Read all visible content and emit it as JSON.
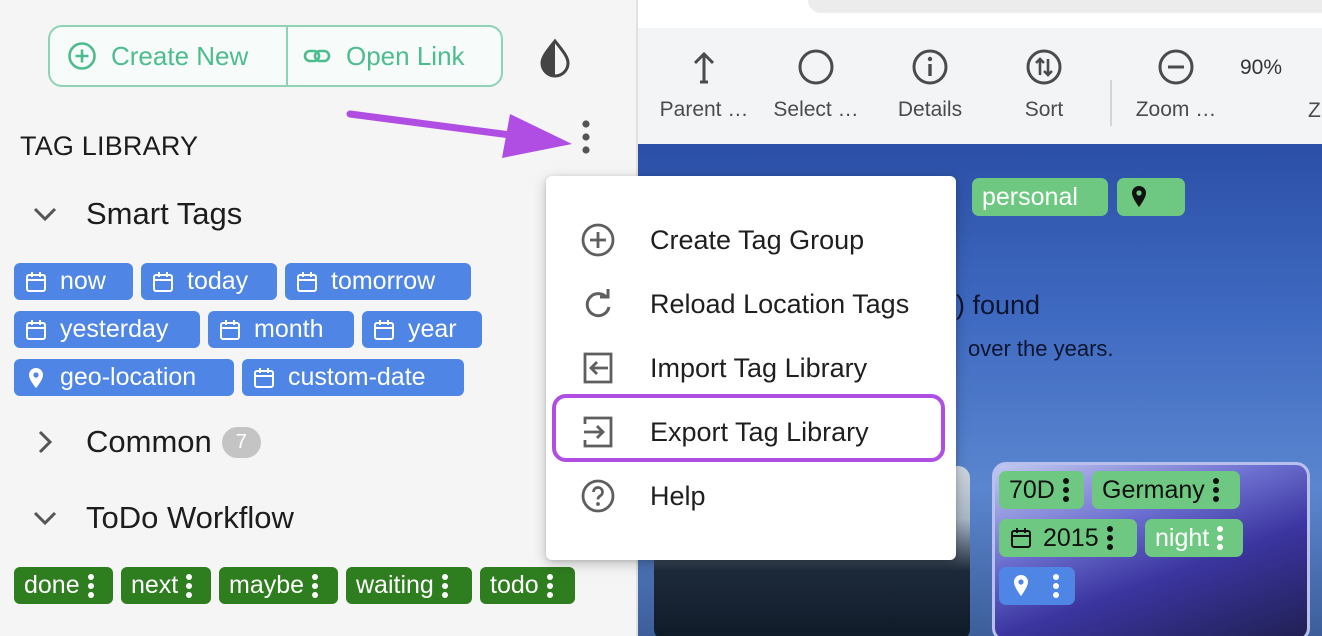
{
  "toolbar_left": {
    "create_new": "Create New",
    "open_link": "Open Link"
  },
  "tag_library": {
    "title": "TAG LIBRARY",
    "groups": [
      {
        "name": "Smart Tags",
        "tags": [
          "now",
          "today",
          "tomorrow",
          "yesterday",
          "month",
          "year",
          "geo-location",
          "custom-date"
        ]
      },
      {
        "name": "Common",
        "count": "7"
      },
      {
        "name": "ToDo Workflow",
        "tags": [
          "done",
          "next",
          "maybe",
          "waiting",
          "todo"
        ]
      }
    ]
  },
  "context_menu": {
    "items": [
      {
        "label": "Create Tag Group",
        "icon": "plus-circle-icon"
      },
      {
        "label": "Reload Location Tags",
        "icon": "refresh-icon"
      },
      {
        "label": "Import Tag Library",
        "icon": "import-icon"
      },
      {
        "label": "Export Tag Library",
        "icon": "export-icon"
      },
      {
        "label": "Help",
        "icon": "help-circle-icon"
      }
    ],
    "highlighted": "Export Tag Library"
  },
  "right_toolbar": {
    "tools": [
      {
        "label": "Parent …",
        "icon": "parent-arrow-icon"
      },
      {
        "label": "Select …",
        "icon": "circle-icon"
      },
      {
        "label": "Details",
        "icon": "info-icon"
      },
      {
        "label": "Sort",
        "icon": "sort-icon"
      },
      {
        "label": "Zoom …",
        "icon": "zoom-out-icon"
      }
    ],
    "zoom_level": "90%",
    "cut_label": "Z"
  },
  "background": {
    "top_tags": [
      "personal"
    ],
    "text_found": ") found",
    "text_years": "over the years.",
    "card_tags": [
      "70D",
      "Germany",
      "2015",
      "night"
    ]
  },
  "colors": {
    "accent": "#4dbd8f",
    "blue_tag": "#4f86e6",
    "green_tag": "#2e7d1e",
    "highlight": "#b04de3"
  }
}
